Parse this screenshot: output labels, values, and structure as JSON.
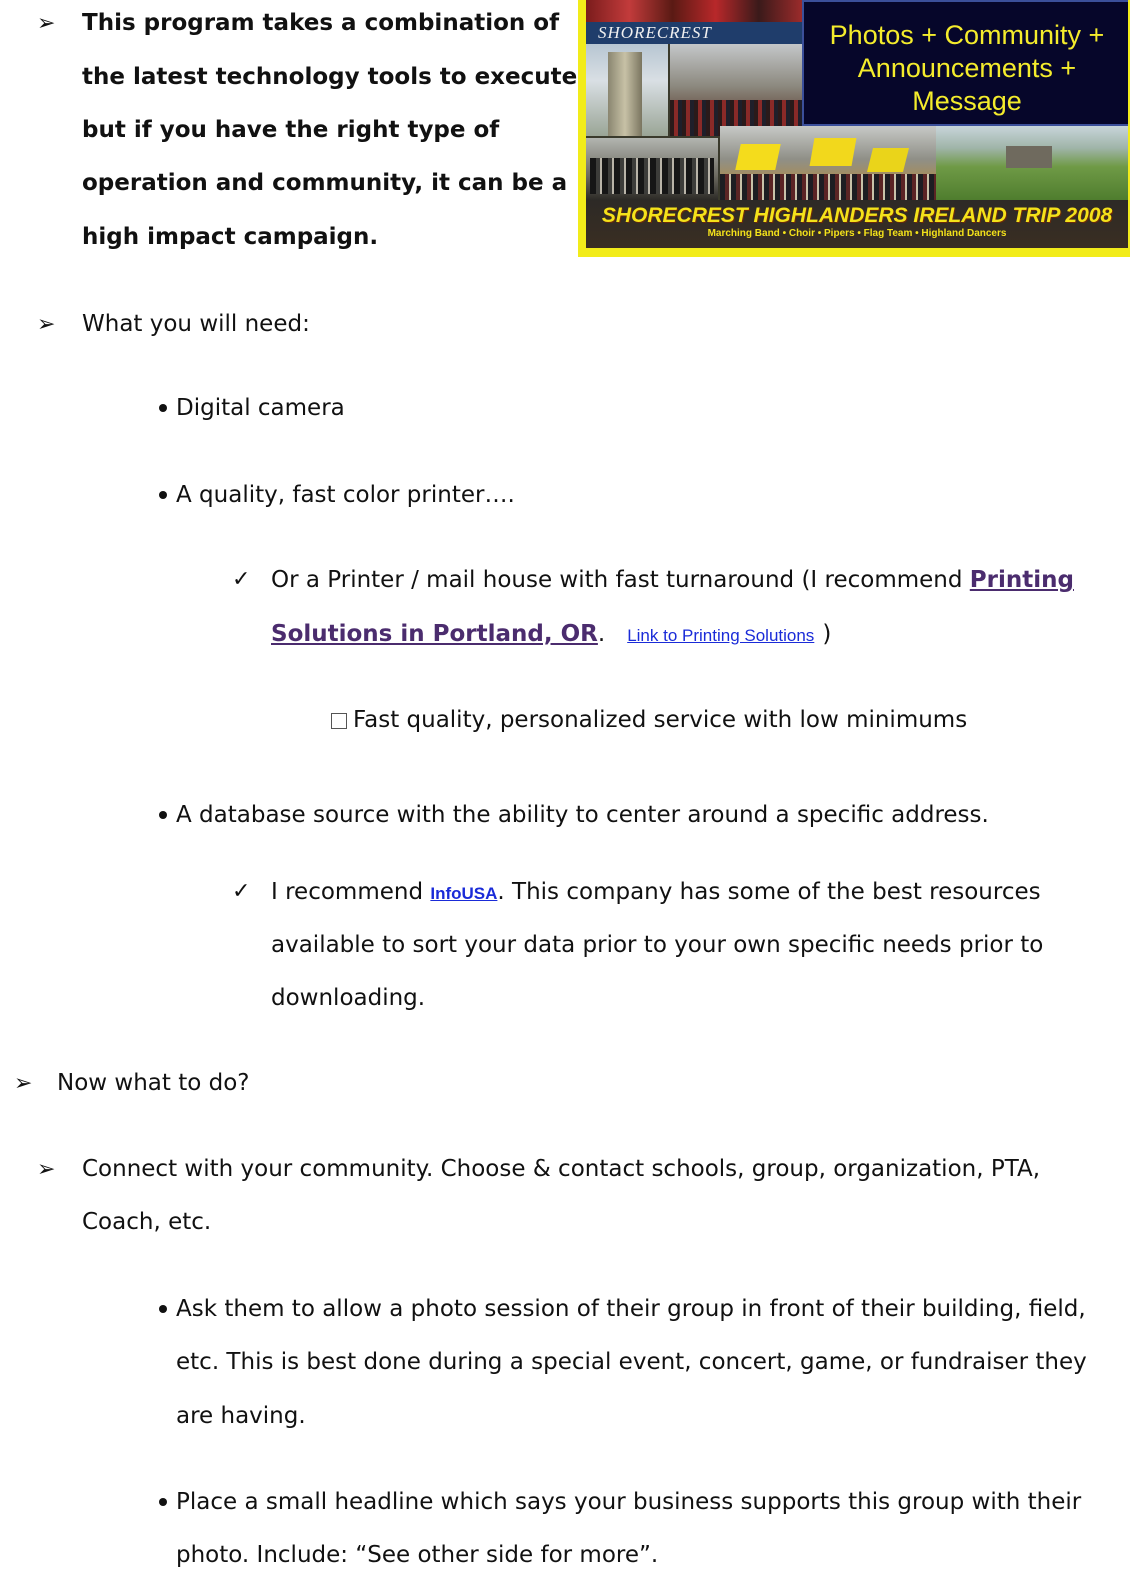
{
  "intro": {
    "lines": [
      "This program takes a combination of",
      "the latest technology tools to execute,",
      "but if you have the right type of",
      "operation and community, it can be a",
      "high impact campaign."
    ]
  },
  "collage": {
    "overlay_lines": [
      "Photos + Community +",
      "Announcements +",
      "Message"
    ],
    "banner_title": "SHORECREST HIGHLANDERS IRELAND TRIP 2008",
    "banner_subtitle": "Marching Band • Choir • Pipers • Flag Team • Highland Dancers",
    "sign_text": "SHORECREST"
  },
  "need": {
    "heading": "What you will need:",
    "camera": "Digital camera",
    "printer": "A quality, fast color printer….",
    "printer_alt_prefix": "Or a Printer / mail house with fast turnaround (I recommend ",
    "printer_alt_link_1": "Printing",
    "printer_alt_link_2": "Solutions in Portland, OR",
    "printer_alt_period": ".",
    "printer_alt_small_link": "Link to Printing Solutions",
    "printer_alt_close": ")",
    "printer_note": "Fast quality, personalized service with low minimums",
    "database": "A database source with the ability to center around a specific address.",
    "db_rec_prefix": "I recommend ",
    "db_rec_link": "InfoUSA",
    "db_rec_line1_rest": ".  This company has some of the best resources",
    "db_rec_line2": "available to sort your data prior to your own specific needs prior to",
    "db_rec_line3": "downloading."
  },
  "todo": {
    "heading": "Now what to do?",
    "connect_line1": "Connect with your community.  Choose & contact schools, group, organization, PTA,",
    "connect_line2": "Coach, etc.",
    "ask_line1": "Ask them to allow a photo session of their group in front of their building, field,",
    "ask_line2": "etc.  This is best done during a special event, concert, game, or fundraiser they",
    "ask_line3": "are having.",
    "place_line1": "Place a small headline which says your business supports this group with their",
    "place_line2": "photo.  Include:  “See other side for more”."
  },
  "colors": {
    "link_visited": "#4b2c6e",
    "link_blue": "#1a2bd8",
    "overlay_text": "#f4ec2c",
    "frame_yellow": "#f2ec1a"
  }
}
